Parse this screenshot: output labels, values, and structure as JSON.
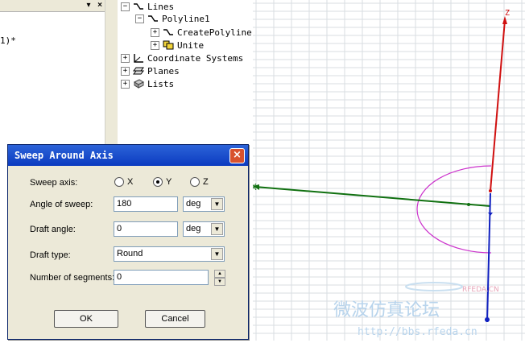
{
  "left_panel": {
    "close_glyph": "×",
    "scroll_glyph": "▾",
    "code_text": "1)*"
  },
  "tree": {
    "items": [
      {
        "label": "Lines",
        "expander": "−",
        "icon": "line-icon"
      },
      {
        "label": "Polyline1",
        "expander": "−",
        "icon": "polyline-icon"
      },
      {
        "label": "CreatePolyline",
        "expander": "+",
        "icon": "create-polyline-icon"
      },
      {
        "label": "Unite",
        "expander": "+",
        "icon": "unite-icon"
      },
      {
        "label": "Coordinate Systems",
        "expander": "+",
        "icon": "coordinate-systems-icon"
      },
      {
        "label": "Planes",
        "expander": "+",
        "icon": "planes-icon"
      },
      {
        "label": "Lists",
        "expander": "+",
        "icon": "lists-icon"
      }
    ]
  },
  "viewport": {
    "axis_z_label": "Z",
    "axis_x_label": "X",
    "watermark_cn": "微波仿真论坛",
    "watermark_url": "http://bbs.rfeda.cn",
    "watermark_brand": "RFEDA.CN",
    "colors": {
      "z_axis": "#d01010",
      "x_axis": "#107010",
      "y_axis": "#1020c0",
      "arc": "#cc33cc",
      "grid": "#d9dde2"
    }
  },
  "dialog": {
    "title": "Sweep Around Axis",
    "close_glyph": "×",
    "sweep_axis_label": "Sweep axis:",
    "axis_options": [
      {
        "label": "X",
        "selected": false
      },
      {
        "label": "Y",
        "selected": true
      },
      {
        "label": "Z",
        "selected": false
      }
    ],
    "angle_label": "Angle of sweep:",
    "angle_value": "180",
    "angle_unit": "deg",
    "draft_angle_label": "Draft angle:",
    "draft_angle_value": "0",
    "draft_angle_unit": "deg",
    "draft_type_label": "Draft type:",
    "draft_type_value": "Round",
    "segments_label": "Number of segments:",
    "segments_value": "0",
    "ok_label": "OK",
    "cancel_label": "Cancel"
  }
}
